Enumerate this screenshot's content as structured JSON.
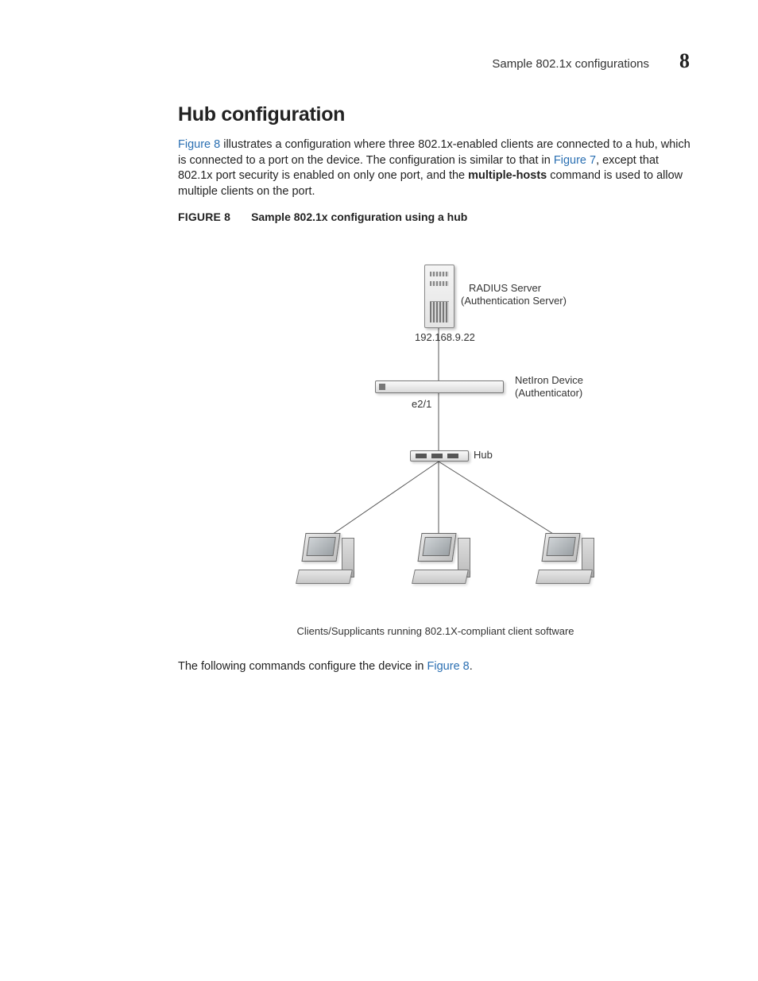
{
  "header": {
    "running_title": "Sample 802.1x configurations",
    "chapter_number": "8"
  },
  "section": {
    "title": "Hub configuration",
    "para_parts": {
      "p1a": " illustrates a configuration where three 802.1x-enabled clients are connected to a hub, which is connected to a port on the device. The configuration is similar to that in ",
      "p1b": ", except that 802.1x port security is enabled on only one port, and the ",
      "p1_bold": "multiple-hosts",
      "p1c": " command is used to allow multiple clients on the port."
    },
    "link_fig8": "Figure 8",
    "link_fig7": "Figure 7"
  },
  "figure": {
    "lead": "FIGURE 8",
    "caption": "Sample 802.1x configuration using a hub",
    "labels": {
      "radius_line1": "RADIUS Server",
      "radius_line2": "(Authentication Server)",
      "radius_ip": "192.168.9.22",
      "device_line1": "NetIron Device",
      "device_line2": "(Authenticator)",
      "port": "e2/1",
      "hub": "Hub",
      "clients_caption": "Clients/Supplicants running 802.1X-compliant client software"
    }
  },
  "trailing": {
    "text_a": "The following commands configure the device in ",
    "link": "Figure 8",
    "text_b": "."
  }
}
